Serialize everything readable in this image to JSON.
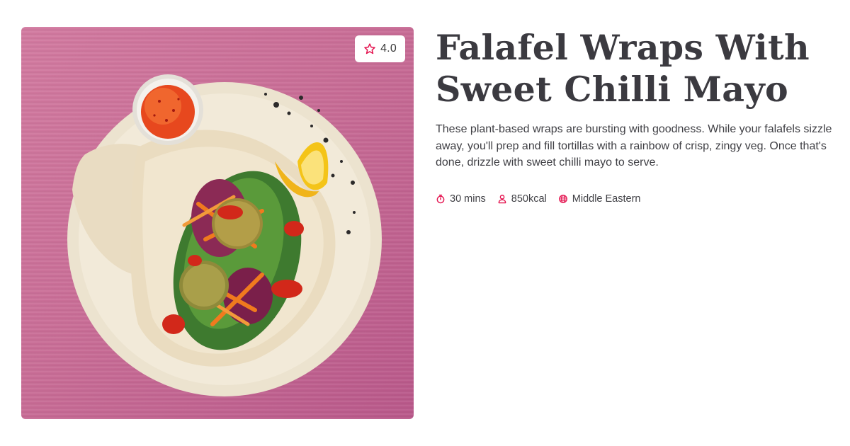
{
  "recipe": {
    "title": "Falafel Wraps With Sweet Chilli Mayo",
    "description": "These plant-based wraps are bursting with goodness. While your falafels sizzle away, you'll prep and fill tortillas with a rainbow of crisp, zingy veg. Once that's done, drizzle with sweet chilli mayo to serve.",
    "rating": "4.0",
    "rating_icon": "star-outline-icon",
    "meta": {
      "time": "30 mins",
      "time_icon": "timer-icon",
      "calories": "850kcal",
      "calories_icon": "person-icon",
      "cuisine": "Middle Eastern",
      "cuisine_icon": "globe-icon"
    }
  },
  "image": {
    "subject": "falafel-wrap-plate-photo",
    "background_color": "#c96d96"
  },
  "colors": {
    "accent": "#e4134f",
    "title": "#3b3a40",
    "body_text": "#3f3f44"
  }
}
